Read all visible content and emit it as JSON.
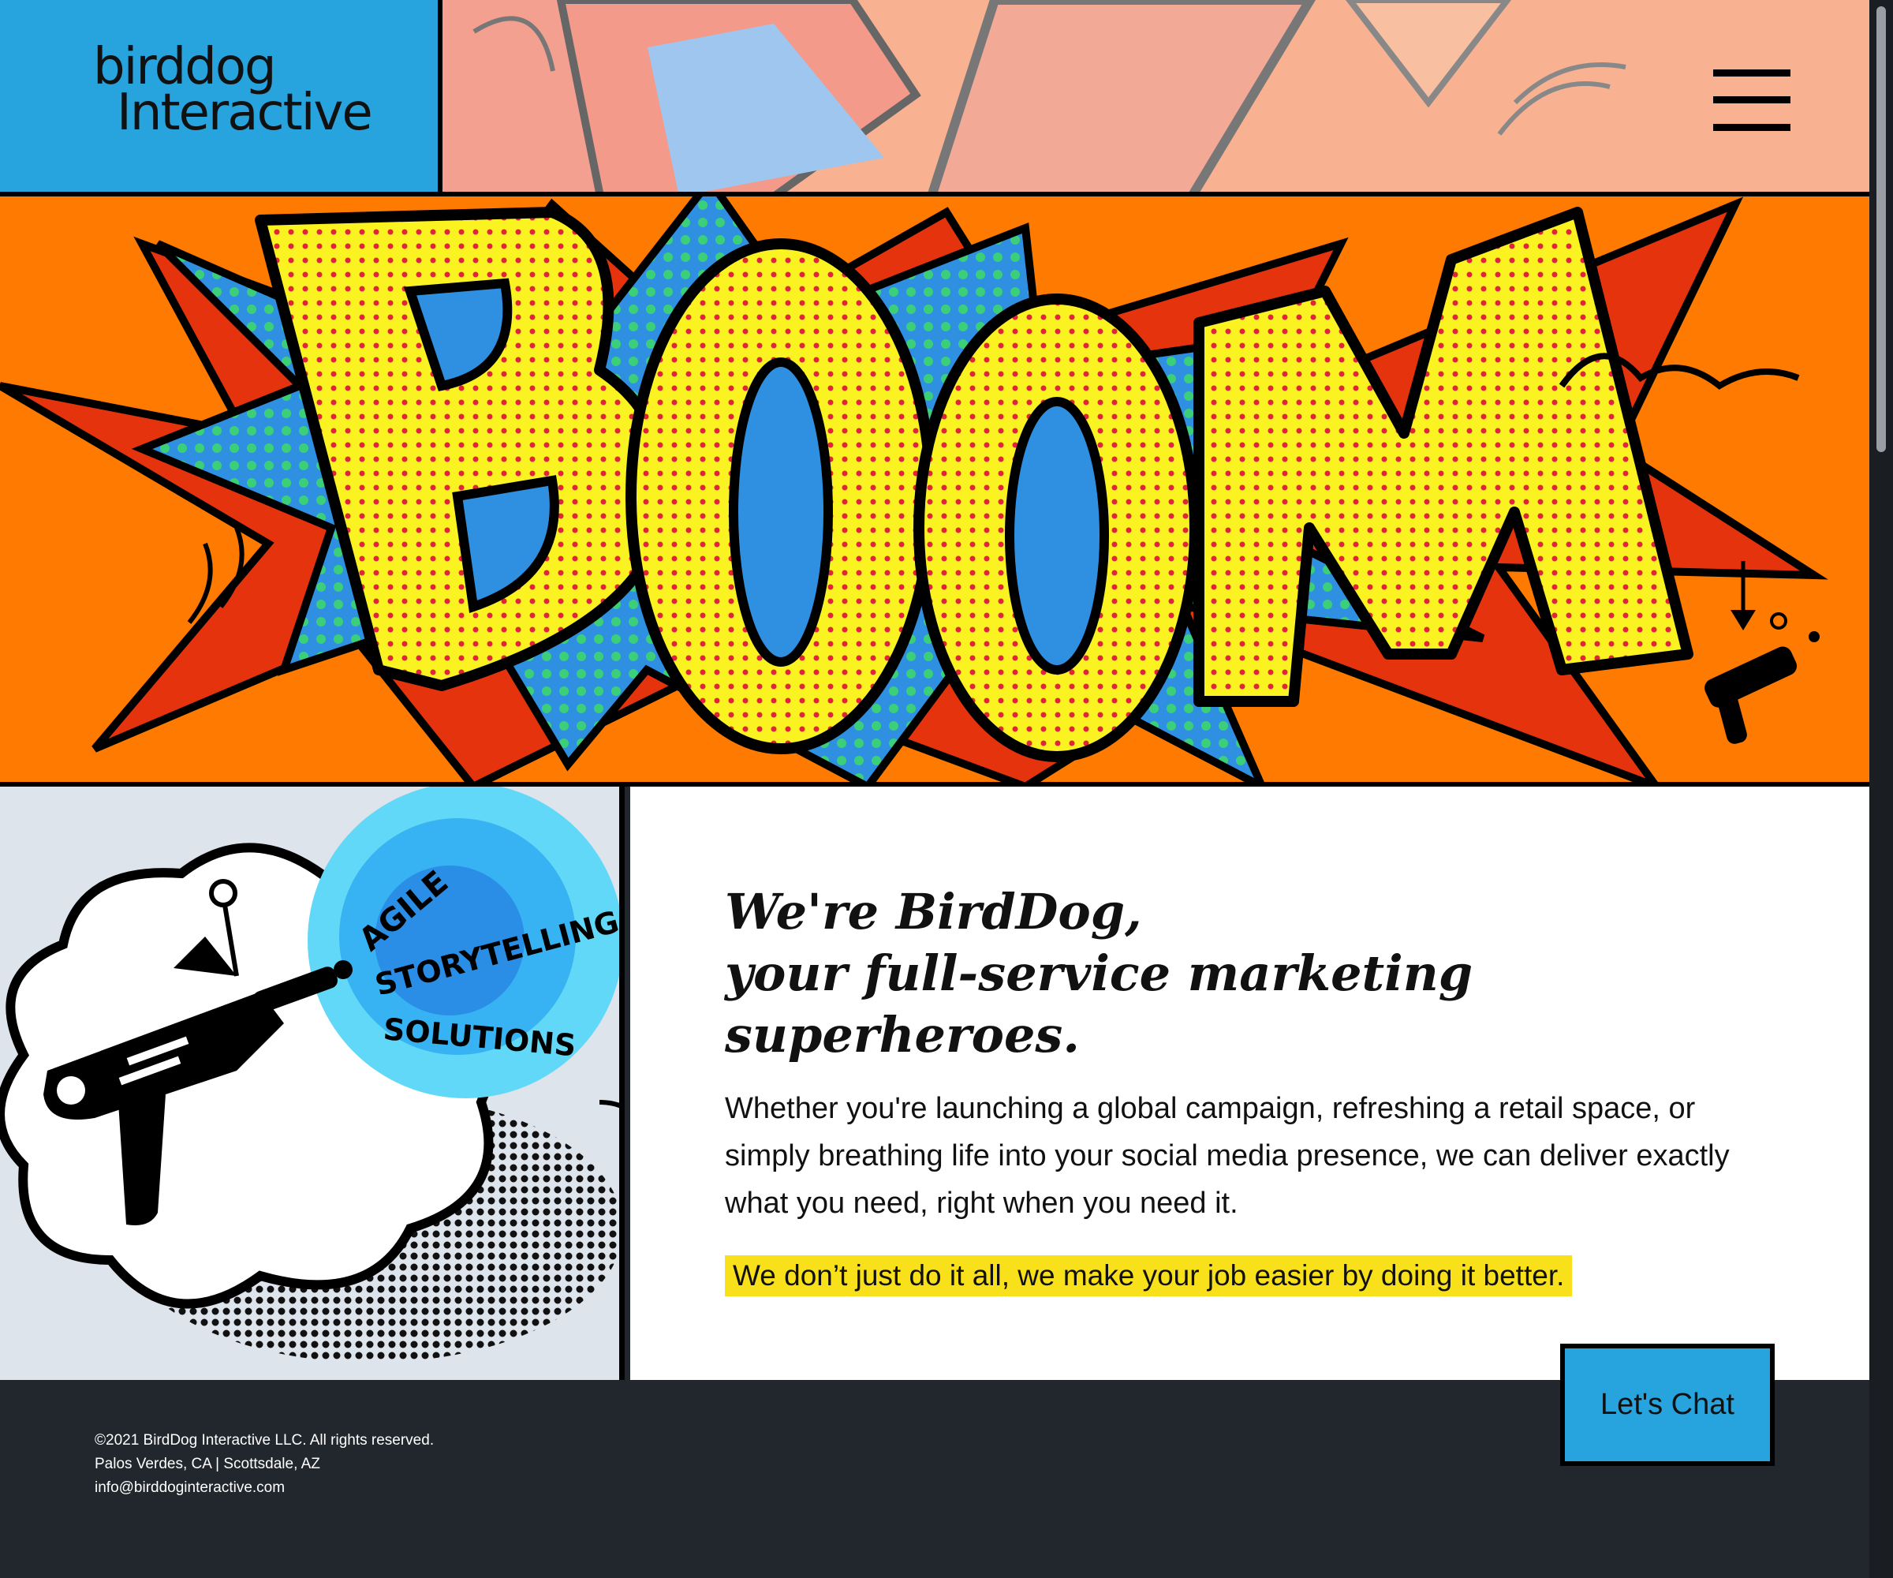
{
  "header": {
    "logo_line1": "birddog",
    "logo_line2": "Interactive",
    "menu_icon": "hamburger-menu-icon"
  },
  "hero": {
    "art_text": "BOOM",
    "scroll_icon": "down-arrow-icon"
  },
  "about": {
    "art_words": [
      "AGILE",
      "STORYTELLING",
      "SOLUTIONS"
    ],
    "headline_line1": "We're BirdDog,",
    "headline_line2": "your full-service marketing",
    "headline_line3": "superheroes.",
    "body": "Whether you're launching a global campaign, refreshing a retail space, or simply breathing life into your social media presence, we can deliver exactly what you need, right when you need it.",
    "highlight": "We don’t just do it all, we make your job easier by doing it better."
  },
  "cta": {
    "label": "Let's Chat"
  },
  "footer": {
    "copyright": "©2021 BirdDog Interactive LLC. All rights reserved.",
    "locations": "Palos Verdes, CA | Scottsdale, AZ",
    "email": "info@birddoginteractive.com"
  },
  "colors": {
    "brand_blue": "#27a3dd",
    "hero_orange": "#ff7a00",
    "highlight_yellow": "#f8e11a",
    "footer_dark": "#22272d"
  }
}
